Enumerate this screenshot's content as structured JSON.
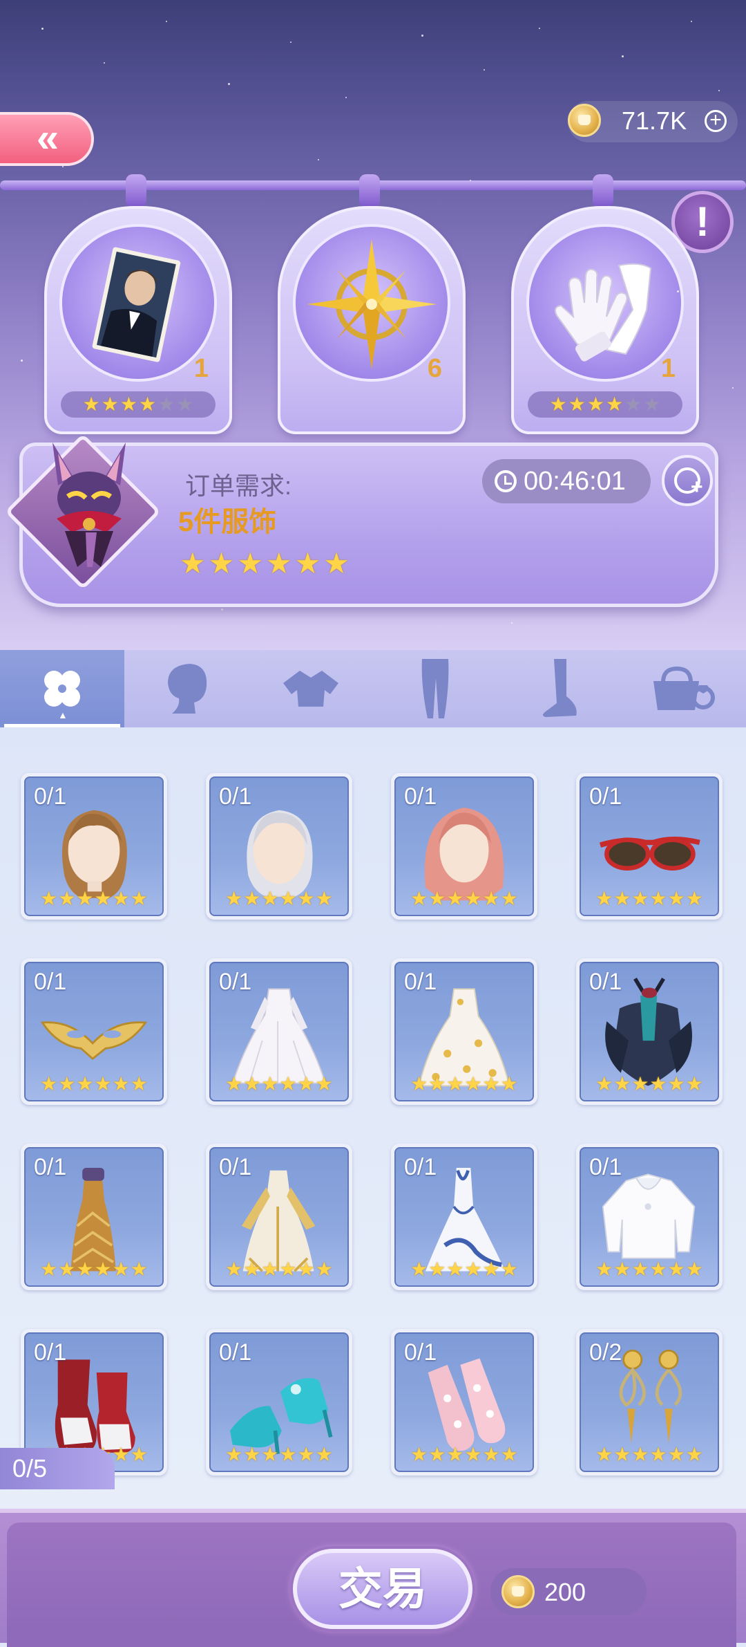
{
  "header": {
    "currency_amount": "71.7K",
    "back_glyph": "«",
    "plus_glyph": "+",
    "alert_glyph": "!"
  },
  "requirements": [
    {
      "name": "portrait-card",
      "count": "1",
      "stars": 4,
      "max_stars": 6
    },
    {
      "name": "compass-star",
      "count": "6"
    },
    {
      "name": "white-gloves",
      "count": "1",
      "stars": 4,
      "max_stars": 6
    }
  ],
  "order": {
    "label": "订单需求:",
    "value": "5件服饰",
    "stars": 6,
    "timer": "00:46:01"
  },
  "tabs": [
    {
      "name": "all",
      "icon": "clover-icon",
      "active": true
    },
    {
      "name": "hair",
      "icon": "hair-silhouette-icon"
    },
    {
      "name": "top",
      "icon": "top-garment-icon"
    },
    {
      "name": "bottom",
      "icon": "legs-icon"
    },
    {
      "name": "shoes",
      "icon": "foot-icon"
    },
    {
      "name": "accessory",
      "icon": "bag-ring-icon"
    }
  ],
  "items": [
    {
      "name": "brown-hair",
      "qty": "0/1",
      "stars": 6
    },
    {
      "name": "silver-hair",
      "qty": "0/1",
      "stars": 6
    },
    {
      "name": "pink-hair",
      "qty": "0/1",
      "stars": 6
    },
    {
      "name": "red-sunglasses",
      "qty": "0/1",
      "stars": 6
    },
    {
      "name": "gold-mask",
      "qty": "0/1",
      "stars": 6
    },
    {
      "name": "white-gown",
      "qty": "0/1",
      "stars": 6
    },
    {
      "name": "floral-gown",
      "qty": "0/1",
      "stars": 6
    },
    {
      "name": "dark-feather-dress",
      "qty": "0/1",
      "stars": 6
    },
    {
      "name": "gold-dress",
      "qty": "0/1",
      "stars": 6
    },
    {
      "name": "gold-white-gown",
      "qty": "0/1",
      "stars": 6
    },
    {
      "name": "blue-white-gown",
      "qty": "0/1",
      "stars": 6
    },
    {
      "name": "white-blouse",
      "qty": "0/1",
      "stars": 6
    },
    {
      "name": "red-white-boots",
      "qty": "0/1",
      "stars": 6
    },
    {
      "name": "teal-heels",
      "qty": "0/1",
      "stars": 6
    },
    {
      "name": "pink-socks",
      "qty": "0/1",
      "stars": 6
    },
    {
      "name": "gold-earrings",
      "qty": "0/2",
      "stars": 6
    }
  ],
  "progress": "0/5",
  "trade": {
    "label": "交易",
    "cost": "200"
  },
  "colors": {
    "star_on": "#ffd447",
    "order_accent": "#e79a22",
    "tab_active": "#7d8fd5"
  }
}
